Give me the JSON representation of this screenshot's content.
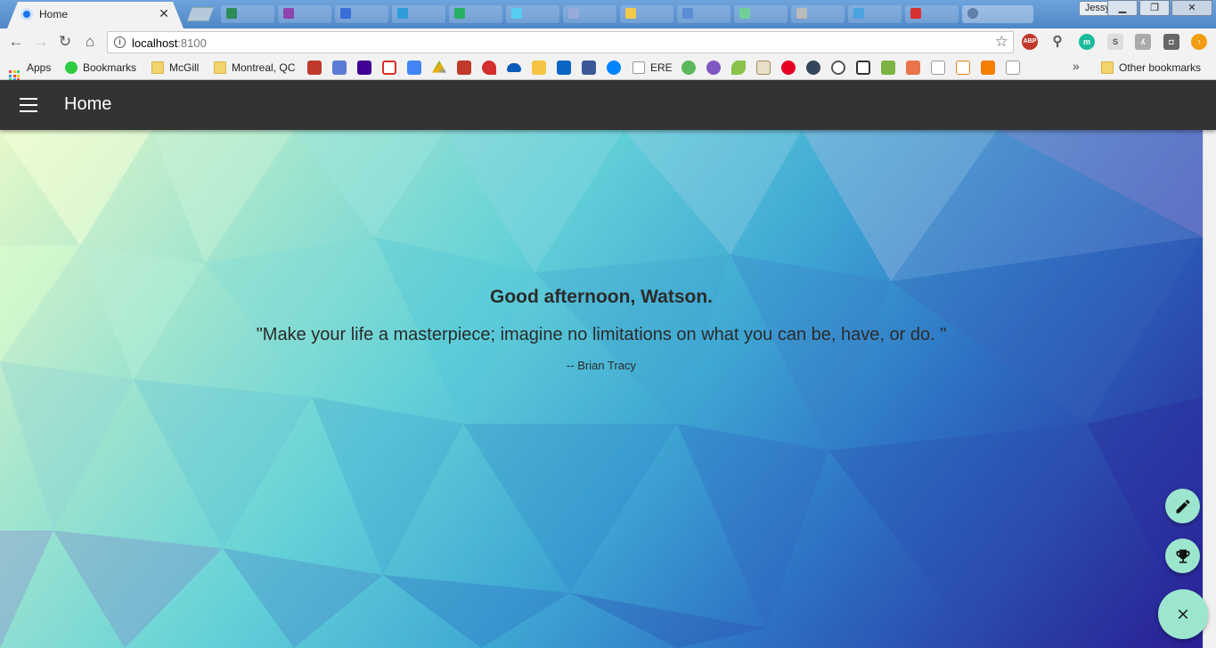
{
  "browser": {
    "tab": {
      "title": "Home",
      "close_glyph": "✕"
    },
    "profile": "Jessy",
    "window_controls": {
      "minimize": "▁",
      "restore": "❐",
      "close": "✕"
    },
    "url": {
      "host": "localhost",
      "port": ":8100"
    },
    "bookmarks": {
      "apps_label": "Apps",
      "items": [
        "Bookmarks",
        "McGill",
        "Montreal, QC",
        "ERE"
      ],
      "overflow": "»",
      "other": "Other bookmarks"
    },
    "extensions": [
      "ABP",
      "m"
    ]
  },
  "app": {
    "header_title": "Home",
    "greeting": "Good afternoon, Watson.",
    "quote": "\"Make your life a masterpiece; imagine no limitations on what you can be, have, or do. \"",
    "author": "-- Brian Tracy",
    "fab_color": "#9ce6d0",
    "header_color": "#333333"
  }
}
